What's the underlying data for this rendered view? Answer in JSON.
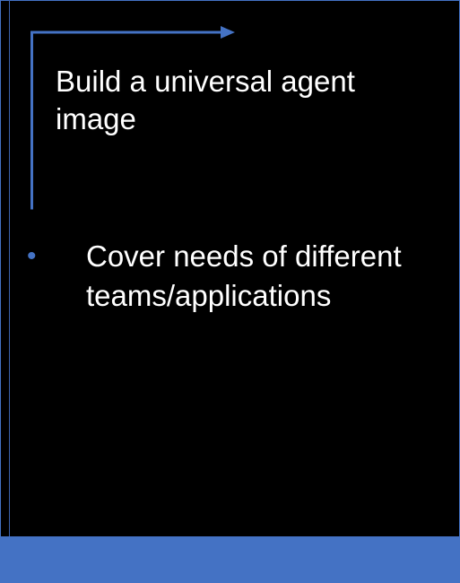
{
  "slide": {
    "heading": "Build a universal agent image",
    "bullets": [
      "Cover needs of different teams/applications"
    ]
  },
  "colors": {
    "background": "#000000",
    "accent": "#4472c4",
    "text": "#ffffff"
  },
  "icons": {
    "bent_arrow": "right-angle-arrow-icon",
    "bullet": "bullet-icon"
  }
}
